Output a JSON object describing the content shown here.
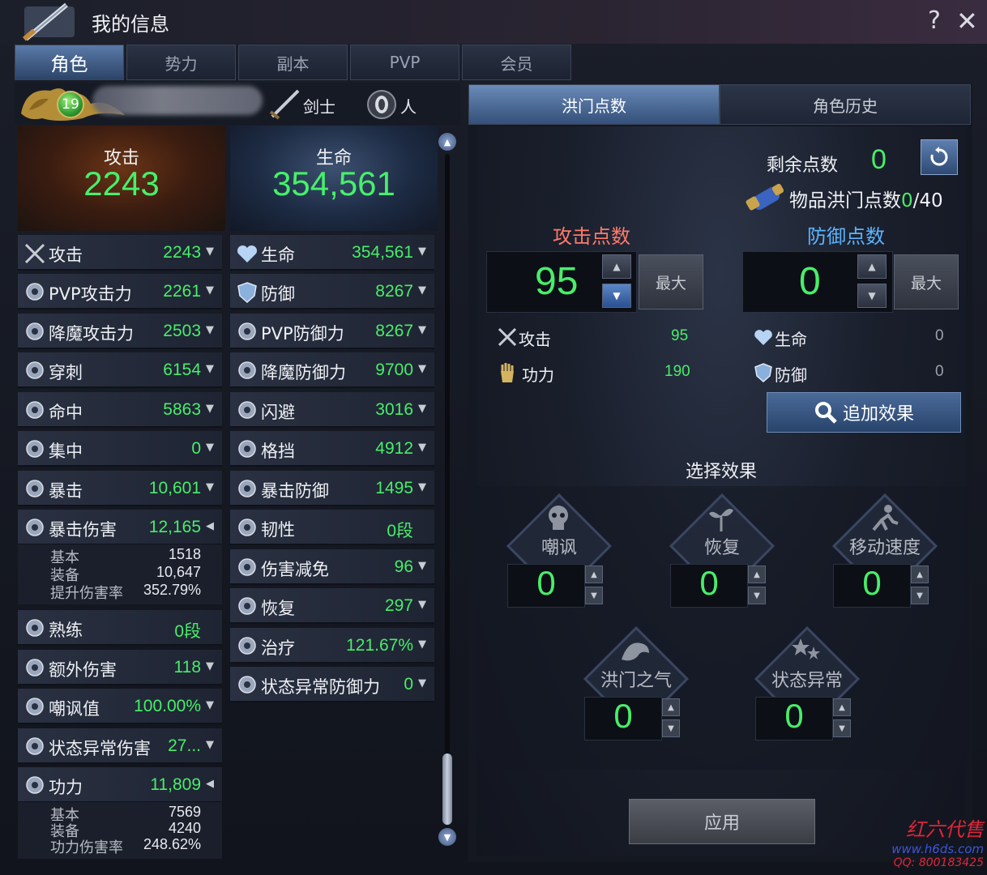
{
  "window": {
    "title": "我的信息",
    "help": "?",
    "close": "✕"
  },
  "main_tabs": [
    "角色",
    "势力",
    "副本",
    "PVP",
    "会员"
  ],
  "character": {
    "level": "19",
    "class": "剑士",
    "race": "人"
  },
  "big_stats": {
    "attack": {
      "label": "攻击",
      "value": "2243"
    },
    "hp": {
      "label": "生命",
      "value": "354,561"
    }
  },
  "left_stats": [
    {
      "label": "攻击",
      "value": "2243",
      "icon": "sword-icon"
    },
    {
      "label": "PVP攻击力",
      "value": "2261",
      "icon": "pvp-attack-icon"
    },
    {
      "label": "降魔攻击力",
      "value": "2503",
      "icon": "demon-attack-icon"
    },
    {
      "label": "穿刺",
      "value": "6154",
      "icon": "pierce-icon"
    },
    {
      "label": "命中",
      "value": "5863",
      "icon": "target-icon"
    },
    {
      "label": "集中",
      "value": "0",
      "icon": "focus-icon"
    },
    {
      "label": "暴击",
      "value": "10,601",
      "icon": "critical-icon"
    },
    {
      "label": "暴击伤害",
      "value": "12,165",
      "icon": "critical-damage-icon"
    },
    {
      "label": "熟练",
      "value": "0段",
      "icon": "mastery-icon"
    },
    {
      "label": "额外伤害",
      "value": "118",
      "icon": "extra-damage-icon"
    },
    {
      "label": "嘲讽值",
      "value": "100.00%",
      "icon": "taunt-icon"
    },
    {
      "label": "状态异常伤害",
      "value": "27...",
      "icon": "status-damage-icon"
    },
    {
      "label": "功力",
      "value": "11,809",
      "icon": "power-icon"
    }
  ],
  "crit_damage_detail": [
    {
      "label": "基本",
      "value": "1518"
    },
    {
      "label": "装备",
      "value": "10,647"
    },
    {
      "label": "提升伤害率",
      "value": "352.79%"
    }
  ],
  "power_detail": [
    {
      "label": "基本",
      "value": "7569"
    },
    {
      "label": "装备",
      "value": "4240"
    },
    {
      "label": "功力伤害率",
      "value": "248.62%"
    }
  ],
  "right_stats": [
    {
      "label": "生命",
      "value": "354,561",
      "icon": "heart-icon"
    },
    {
      "label": "防御",
      "value": "8267",
      "icon": "shield-icon"
    },
    {
      "label": "PVP防御力",
      "value": "8267",
      "icon": "pvp-defense-icon"
    },
    {
      "label": "降魔防御力",
      "value": "9700",
      "icon": "demon-defense-icon"
    },
    {
      "label": "闪避",
      "value": "3016",
      "icon": "evade-icon"
    },
    {
      "label": "格挡",
      "value": "4912",
      "icon": "block-icon"
    },
    {
      "label": "暴击防御",
      "value": "1495",
      "icon": "crit-defense-icon"
    },
    {
      "label": "韧性",
      "value": "0段",
      "icon": "toughness-icon"
    },
    {
      "label": "伤害减免",
      "value": "96",
      "icon": "damage-reduction-icon"
    },
    {
      "label": "恢复",
      "value": "297",
      "icon": "recovery-icon"
    },
    {
      "label": "治疗",
      "value": "121.67%",
      "icon": "heal-icon"
    },
    {
      "label": "状态异常防御力",
      "value": "0",
      "icon": "status-defense-icon"
    }
  ],
  "sub_tabs": [
    "洪门点数",
    "角色历史"
  ],
  "points": {
    "remain_label": "剩余点数",
    "remain_value": "0",
    "item_label": "物品洪门点数",
    "item_current": "0",
    "item_total": "/40",
    "attack_title": "攻击点数",
    "defense_title": "防御点数",
    "attack_value": "95",
    "defense_value": "0",
    "max_label": "最大"
  },
  "attack_bonus": [
    {
      "label": "攻击",
      "value": "95"
    },
    {
      "label": "功力",
      "value": "190"
    }
  ],
  "defense_bonus": [
    {
      "label": "生命",
      "value": "0"
    },
    {
      "label": "防御",
      "value": "0"
    }
  ],
  "add_effect_label": "追加效果",
  "select_effect_title": "选择效果",
  "effects": [
    {
      "label": "嘲讽",
      "value": "0"
    },
    {
      "label": "恢复",
      "value": "0"
    },
    {
      "label": "移动速度",
      "value": "0"
    },
    {
      "label": "洪门之气",
      "value": "0"
    },
    {
      "label": "状态异常",
      "value": "0"
    }
  ],
  "apply_label": "应用",
  "watermark": {
    "line1": "红六代售",
    "line2": "www.h6ds.com",
    "line3": "QQ: 800183425"
  },
  "colors": {
    "value_green": "#48ee6a",
    "attack_red": "#ff7a6a",
    "defense_blue": "#5ab4ff"
  }
}
